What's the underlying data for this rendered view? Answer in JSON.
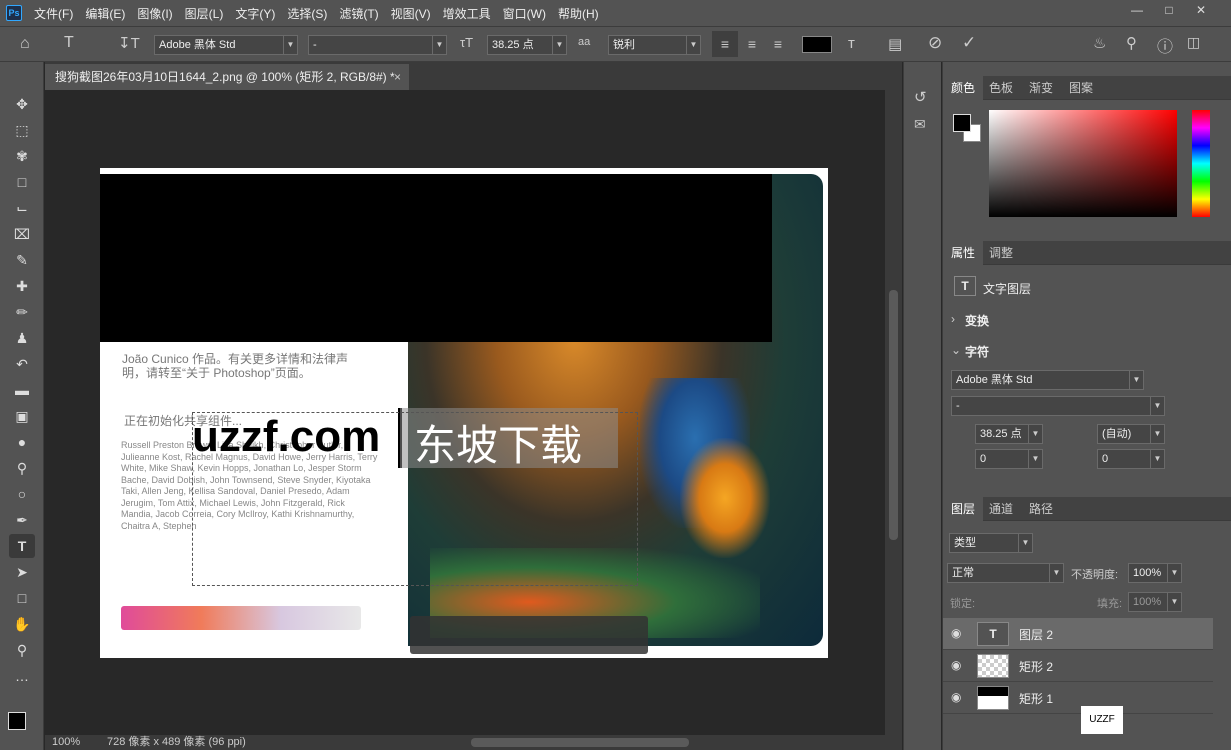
{
  "menubar": {
    "logo": "Ps",
    "items": [
      "文件(F)",
      "编辑(E)",
      "图像(I)",
      "图层(L)",
      "文字(Y)",
      "选择(S)",
      "滤镜(T)",
      "视图(V)",
      "增效工具",
      "窗口(W)",
      "帮助(H)"
    ]
  },
  "options": {
    "font_family": "Adobe 黑体 Std",
    "font_style": "-",
    "font_size": "38.25 点",
    "antialias": "锐利"
  },
  "tab": {
    "title": "搜狗截图26年03月10日1644_2.png @ 100% (矩形 2, RGB/8#) *",
    "close": "×"
  },
  "canvas": {
    "overlay_text": "uzzf.com",
    "overlay_cn": "东坡下载",
    "splash_credit": "João Cunico 作品。有关更多详情和法律声明，请转至“关于 Photoshop”页面。",
    "splash_status": "正在初始化共享组件...",
    "splash_names": "Russell Preston Brown, Lisa Sheikh, Christopher Butler, Julieanne Kost, Rachel Magnus, David Howe, Jerry Harris, Terry White, Mike Shaw, Kevin Hopps, Jonathan Lo, Jesper Storm Bache, David Dobish, John Townsend, Steve Snyder, Kiyotaka Taki, Allen Jeng, Kellisa Sandoval, Daniel Presedo, Adam Jerugim, Tom Attix, Michael Lewis, John Fitzgerald, Rick Mandia, Jacob Correia, Cory McIlroy, Kathi Krishnamurthy, Chaitra A, Stephen"
  },
  "status": {
    "zoom": "100%",
    "size": "728 像素 x 489 像素 (96 ppi)"
  },
  "color_panel": {
    "tabs": [
      "颜色",
      "色板",
      "渐变",
      "图案"
    ]
  },
  "props_panel": {
    "tabs": [
      "属性",
      "调整"
    ],
    "layer_type": "文字图层",
    "transform": "变换",
    "character": "字符",
    "font_family": "Adobe 黑体 Std",
    "font_style": "-",
    "size": "38.25 点",
    "leading": "(自动)",
    "kerning": "0",
    "tracking": "0"
  },
  "layers_panel": {
    "tabs": [
      "图层",
      "通道",
      "路径"
    ],
    "filter": "类型",
    "blend": "正常",
    "opacity_label": "不透明度:",
    "opacity": "100%",
    "lock_label": "锁定:",
    "fill_label": "填充:",
    "fill": "100%",
    "layers": [
      {
        "name": "图层 2"
      },
      {
        "name": "矩形 2"
      },
      {
        "name": "矩形 1"
      }
    ]
  },
  "watermark": "UZZF",
  "colors": {
    "fg": "#000000",
    "bg": "#ffffff",
    "accent": "#31a8ff"
  }
}
